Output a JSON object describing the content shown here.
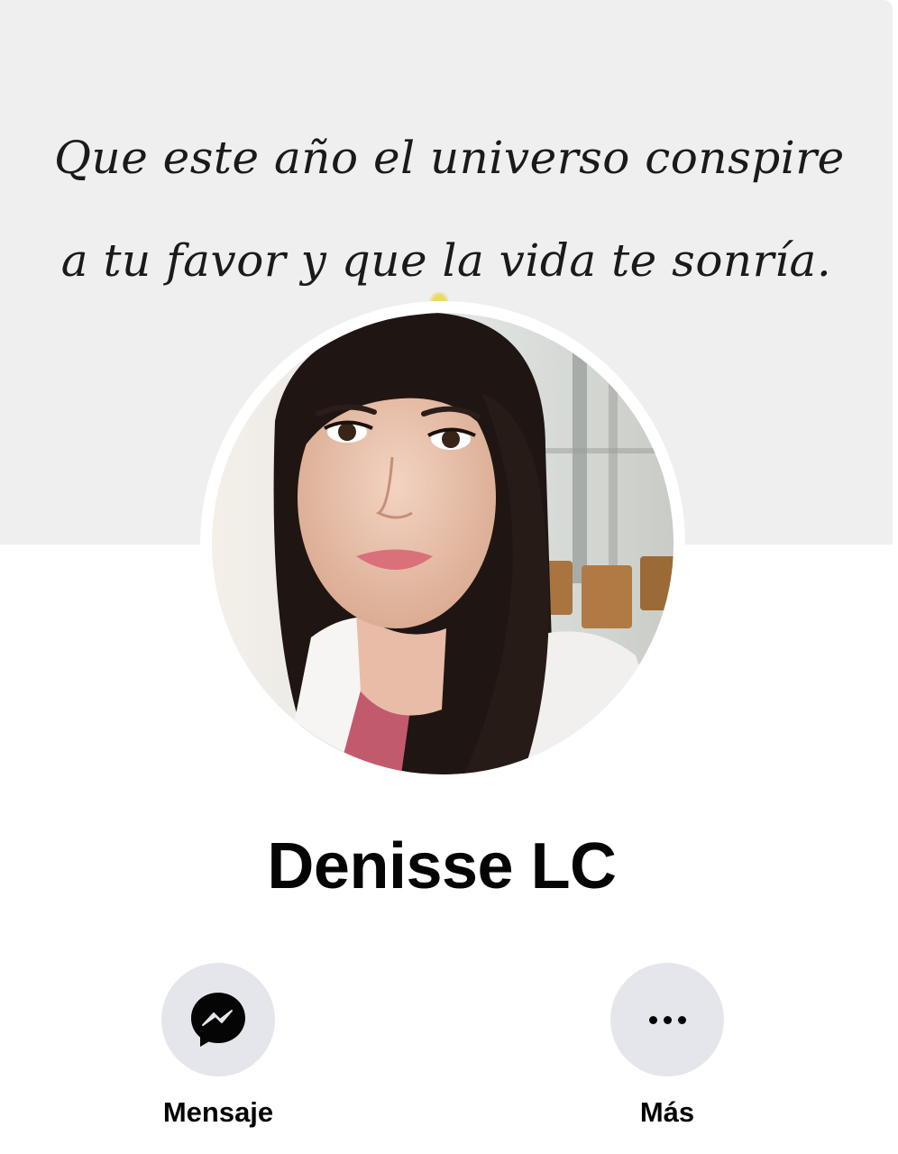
{
  "cover": {
    "quote_line_1": "Que este año el universo conspire",
    "quote_line_2": "a tu favor y que la  vida te sonría."
  },
  "profile": {
    "name": "Denisse LC"
  },
  "actions": [
    {
      "label": "Mensaje",
      "icon": "messenger-icon"
    },
    {
      "label": "Más",
      "icon": "more-dots-icon"
    }
  ],
  "colors": {
    "cover_bg": "#efefef",
    "button_bg": "#e4e6eb",
    "text": "#050505"
  }
}
